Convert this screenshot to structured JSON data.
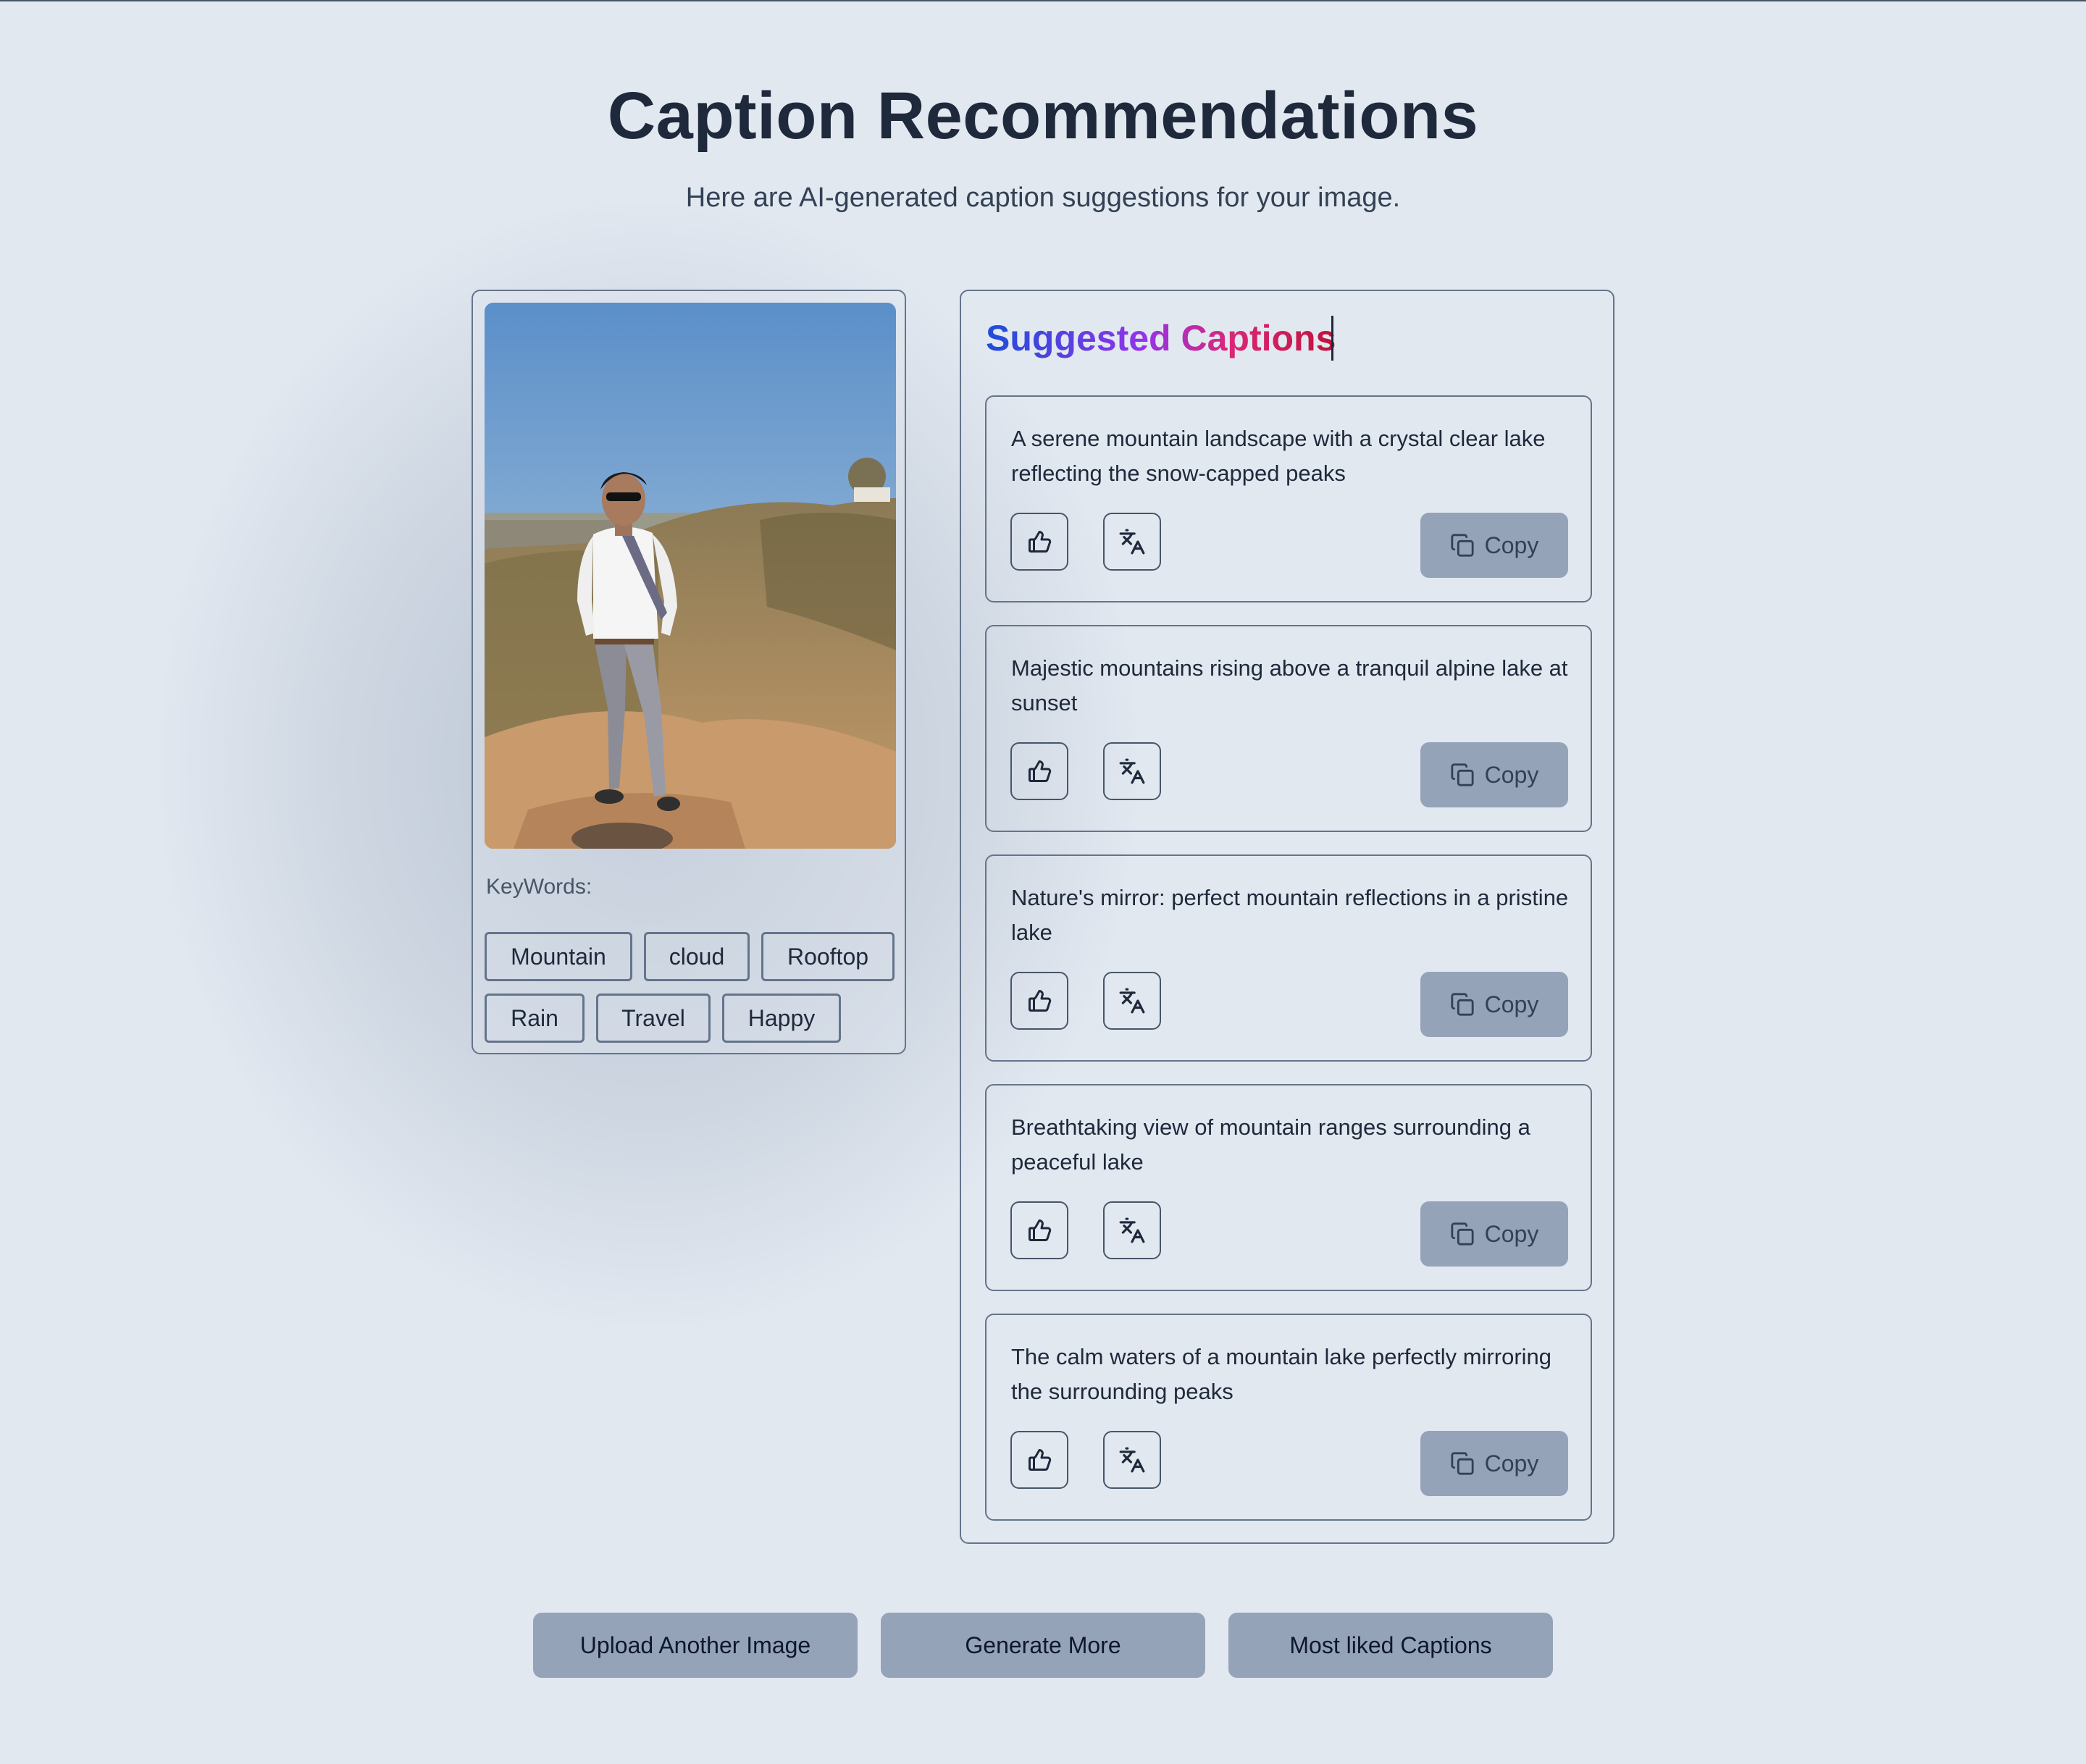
{
  "page": {
    "title": "Caption Recommendations",
    "subtitle": "Here are AI-generated caption suggestions for your image."
  },
  "image_panel": {
    "keywords_label": "KeyWords:",
    "keywords": [
      "Mountain",
      "cloud",
      "Rooftop",
      "Rain",
      "Travel",
      "Happy"
    ]
  },
  "captions_panel": {
    "heading": "Suggested Captions",
    "copy_label": "Copy",
    "captions": [
      "A serene mountain landscape with a crystal clear lake reflecting the snow-capped peaks",
      "Majestic mountains rising above a tranquil alpine lake at sunset",
      "Nature's mirror: perfect mountain reflections in a pristine lake",
      "Breathtaking view of mountain ranges surrounding a peaceful lake",
      "The calm waters of a mountain lake perfectly mirroring the surrounding peaks"
    ]
  },
  "actions": {
    "upload_label": "Upload Another Image",
    "generate_label": "Generate More",
    "most_liked_label": "Most liked Captions"
  },
  "icons": {
    "like": "thumbs-up-icon",
    "translate": "translate-icon",
    "copy": "copy-icon"
  },
  "colors": {
    "background": "#e2e8f0",
    "button": "#94a3b8",
    "border": "#64748b",
    "text": "#1e293b"
  }
}
